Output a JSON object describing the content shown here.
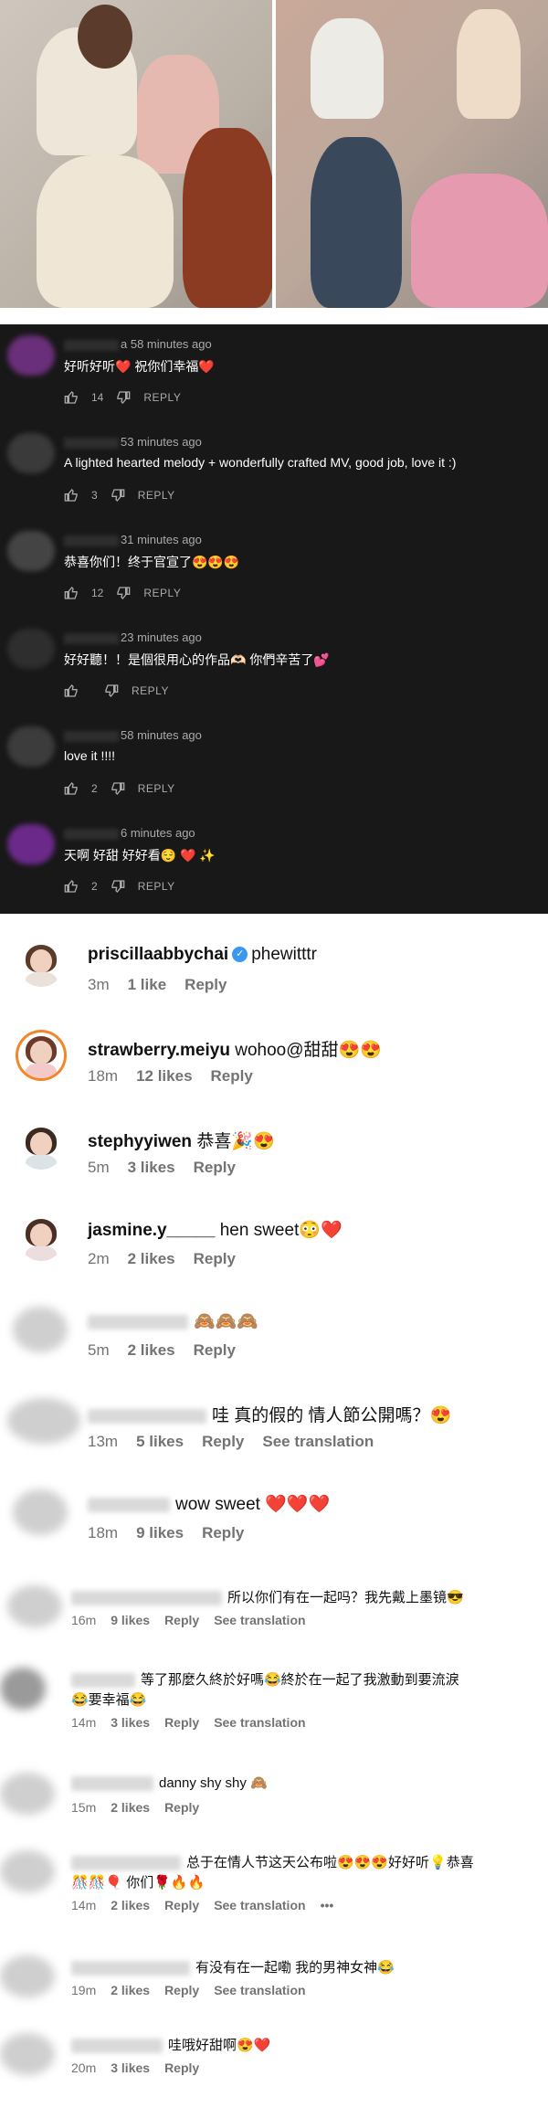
{
  "yt": {
    "comments": [
      {
        "time": "a 58 minutes ago",
        "text": "好听好听❤️  祝你们幸福❤️",
        "likes": "14",
        "reply": "REPLY",
        "avatar_color": "#6a2f7a"
      },
      {
        "time": "53 minutes ago",
        "text": "A lighted hearted melody + wonderfully crafted MV, good job, love it :)",
        "likes": "3",
        "reply": "REPLY",
        "avatar_color": "#3a3a3a"
      },
      {
        "time": "31 minutes ago",
        "text": "恭喜你们！终于官宣了😍😍😍",
        "likes": "12",
        "reply": "REPLY",
        "avatar_color": "#444444"
      },
      {
        "time": "23 minutes ago",
        "text": "好好聽！！是個很用心的作品🫶🏻 你們辛苦了💕",
        "likes": "",
        "reply": "REPLY",
        "avatar_color": "#2e2e2e"
      },
      {
        "time": "58 minutes ago",
        "text": "love it !!!!",
        "likes": "2",
        "reply": "REPLY",
        "avatar_color": "#3c3c3c"
      },
      {
        "time": "6 minutes ago",
        "text": "天啊 好甜 好好看😌 ❤️ ✨",
        "likes": "2",
        "reply": "REPLY",
        "avatar_color": "#6b2a8a"
      }
    ]
  },
  "ig": {
    "comments": [
      {
        "user": "priscillaabbychai",
        "verified": true,
        "text": "phewitttr",
        "time": "3m",
        "likes": "1 like",
        "reply": "Reply",
        "see": ""
      },
      {
        "user": "strawberry.meiyu",
        "text": "wohoo@甜甜😍😍",
        "time": "18m",
        "likes": "12 likes",
        "reply": "Reply",
        "see": ""
      },
      {
        "user": "stephyyiwen",
        "text": "恭喜🎉😍",
        "time": "5m",
        "likes": "3 likes",
        "reply": "Reply",
        "see": ""
      },
      {
        "user": "jasmine.y_____",
        "text": "hen sweet😳❤️",
        "time": "2m",
        "likes": "2 likes",
        "reply": "Reply",
        "see": ""
      },
      {
        "user": "",
        "text": "🙈🙈🙈",
        "time": "5m",
        "likes": "2 likes",
        "reply": "Reply",
        "see": ""
      },
      {
        "user": "",
        "text": "哇 真的假的 情人節公開嗎？😍",
        "time": "13m",
        "likes": "5 likes",
        "reply": "Reply",
        "see": "See translation"
      },
      {
        "user": "",
        "text": "wow sweet ❤️❤️❤️",
        "time": "18m",
        "likes": "9 likes",
        "reply": "Reply",
        "see": ""
      },
      {
        "user": "",
        "text": "所以你们有在一起吗？我先戴上墨镜😎",
        "time": "16m",
        "likes": "9 likes",
        "reply": "Reply",
        "see": "See translation"
      },
      {
        "user": "",
        "text": "等了那麼久終於好嗎😂終於在一起了我激動到要流淚",
        "text2": "😂要幸福😂",
        "time": "14m",
        "likes": "3 likes",
        "reply": "Reply",
        "see": "See translation"
      },
      {
        "user": "",
        "text": "danny shy shy 🙈",
        "time": "15m",
        "likes": "2 likes",
        "reply": "Reply",
        "see": ""
      },
      {
        "user": "",
        "text": "总于在情人节这天公布啦😍😍😍好好听💡恭喜",
        "text2": "🎊🎊🎈 你们🌹🔥🔥",
        "time": "14m",
        "likes": "2 likes",
        "reply": "Reply",
        "see": "See translation",
        "more": "•••"
      },
      {
        "user": "",
        "text": "有没有在一起嘞 我的男神女神😂",
        "time": "19m",
        "likes": "2 likes",
        "reply": "Reply",
        "see": "See translation"
      },
      {
        "user": "",
        "text": "哇哦好甜啊😍❤️",
        "time": "20m",
        "likes": "3 likes",
        "reply": "Reply",
        "see": ""
      }
    ]
  }
}
